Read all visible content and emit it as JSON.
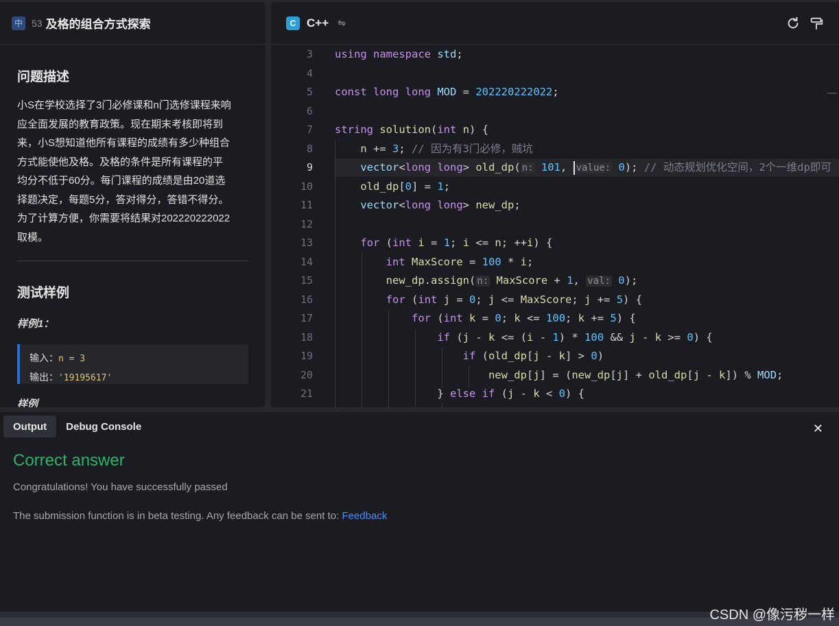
{
  "problem": {
    "difficulty_badge": "中",
    "number": "53",
    "title": "及格的组合方式探索",
    "description_heading": "问题描述",
    "description_lines": [
      "小S在学校选择了3门必修课和n门选修课程来响",
      "应全面发展的教育政策。现在期末考核即将到",
      "来，小S想知道他所有课程的成绩有多少种组合",
      "方式能使他及格。及格的条件是所有课程的平",
      "均分不低于60分。每门课程的成绩是由20道选",
      "择题决定，每题5分，答对得分，答错不得分。",
      "为了计算方便，你需要将结果对202220222022",
      "取模。"
    ],
    "samples_heading": "测试样例",
    "sample1_label": "样例1：",
    "sample1_input_label": "输入：",
    "sample1_input_value": "n = 3",
    "sample1_output_label": "输出：",
    "sample1_output_value": "'19195617'",
    "sample2_label_partial": "样例"
  },
  "editor": {
    "language_icon": "C",
    "language": "C++",
    "switch_icon": "⇋",
    "active_line": 9,
    "line_numbers": [
      "3",
      "4",
      "5",
      "6",
      "7",
      "8",
      "9",
      "10",
      "11",
      "12",
      "13",
      "14",
      "15",
      "16",
      "17",
      "18",
      "19",
      "20",
      "21"
    ]
  },
  "output": {
    "tab_output": "Output",
    "tab_debug": "Debug Console",
    "close": "✕",
    "result_title": "Correct answer",
    "result_message": "Congratulations! You have successfully passed",
    "beta_text": "The submission function is in beta testing. Any feedback can be sent to: ",
    "feedback_link": "Feedback"
  },
  "watermark": "CSDN @像污秽一样",
  "colors": {
    "accent_green": "#2fb36a",
    "link_blue": "#4a8cf0",
    "badge_blue": "#2e4a7a"
  }
}
